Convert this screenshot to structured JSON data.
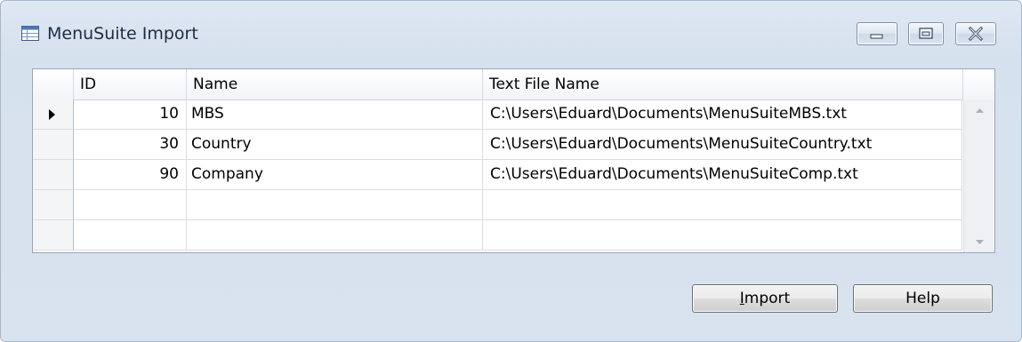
{
  "window": {
    "title": "MenuSuite Import",
    "icon": "table-window-icon"
  },
  "grid": {
    "columns": [
      {
        "key": "id",
        "label": "ID"
      },
      {
        "key": "name",
        "label": "Name"
      },
      {
        "key": "file",
        "label": "Text File Name"
      }
    ],
    "rows": [
      {
        "id": "10",
        "name": "MBS",
        "file": "C:\\Users\\Eduard\\Documents\\MenuSuiteMBS.txt",
        "selected": true
      },
      {
        "id": "30",
        "name": "Country",
        "file": "C:\\Users\\Eduard\\Documents\\MenuSuiteCountry.txt",
        "selected": false
      },
      {
        "id": "90",
        "name": "Company",
        "file": "C:\\Users\\Eduard\\Documents\\MenuSuiteComp.txt",
        "selected": false
      },
      {
        "id": "",
        "name": "",
        "file": "",
        "selected": false
      },
      {
        "id": "",
        "name": "",
        "file": "",
        "selected": false
      }
    ]
  },
  "buttons": {
    "import_accel": "I",
    "import_rest": "mport",
    "help": "Help"
  },
  "colors": {
    "window_bg": "#d9e3ef",
    "grid_border": "#9aa6b5",
    "title_text": "#1b2d44"
  }
}
